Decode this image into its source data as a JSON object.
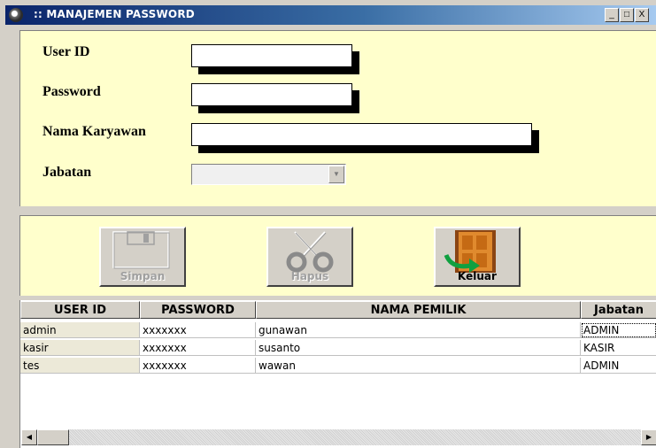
{
  "window": {
    "title": ":: MANAJEMEN PASSWORD",
    "minimize": "_",
    "maximize": "□",
    "close": "X"
  },
  "form": {
    "userid_label": "User ID",
    "password_label": "Password",
    "nama_label": "Nama Karyawan",
    "jabatan_label": "Jabatan",
    "userid_value": "",
    "password_value": "",
    "nama_value": "",
    "jabatan_value": ""
  },
  "buttons": {
    "simpan": "Simpan",
    "hapus": "Hapus",
    "keluar": "Keluar"
  },
  "grid": {
    "columns": [
      "USER ID",
      "PASSWORD",
      "NAMA PEMILIK",
      "Jabatan"
    ],
    "rows": [
      [
        "admin",
        "xxxxxxx",
        "gunawan",
        "ADMIN"
      ],
      [
        "kasir",
        "xxxxxxx",
        "susanto",
        "KASIR"
      ],
      [
        "tes",
        "xxxxxxx",
        "wawan",
        "ADMIN"
      ]
    ]
  },
  "colors": {
    "panel": "#ffffcc",
    "titlebar_start": "#0a246a",
    "titlebar_end": "#a6caf0"
  },
  "icons": [
    "floppy-disk-icon",
    "scissors-icon",
    "exit-door-icon",
    "chevron-down-icon",
    "scroll-left-icon",
    "scroll-right-icon"
  ]
}
